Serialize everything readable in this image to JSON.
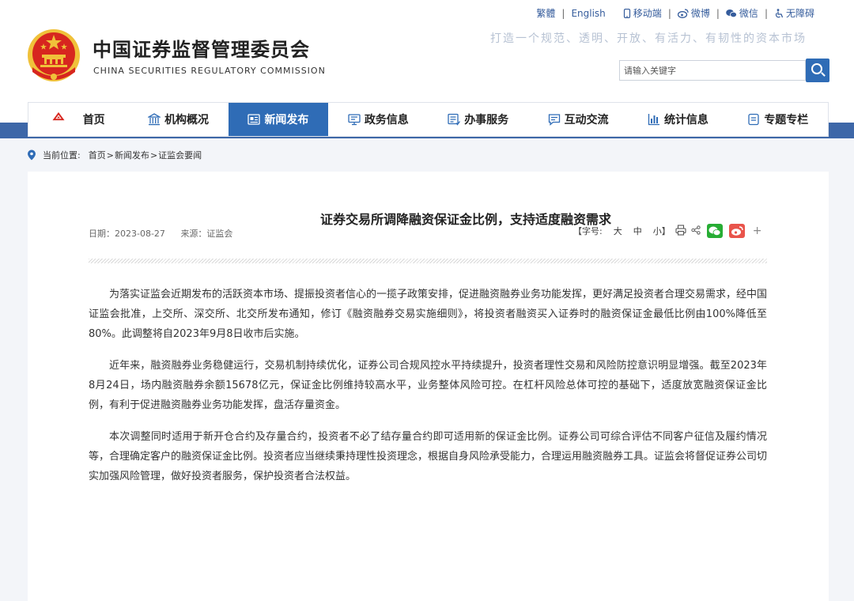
{
  "header": {
    "title_cn": "中国证券监督管理委员会",
    "title_en": "CHINA SECURITIES REGULATORY COMMISSION",
    "slogan": "打造一个规范、透明、开放、有活力、有韧性的资本市场",
    "util_links": {
      "traditional": "繁體",
      "english": "English",
      "mobile": "移动端",
      "weibo": "微博",
      "wechat": "微信",
      "accessibility": "无障碍"
    },
    "search_placeholder": "请输入关键字"
  },
  "nav": [
    {
      "label": "首页",
      "icon": "home-logo-icon"
    },
    {
      "label": "机构概况",
      "icon": "institution-icon"
    },
    {
      "label": "新闻发布",
      "icon": "news-icon",
      "active": true
    },
    {
      "label": "政务信息",
      "icon": "monitor-icon"
    },
    {
      "label": "办事服务",
      "icon": "list-icon"
    },
    {
      "label": "互动交流",
      "icon": "chat-icon"
    },
    {
      "label": "统计信息",
      "icon": "chart-icon"
    },
    {
      "label": "专题专栏",
      "icon": "topic-icon"
    }
  ],
  "breadcrumb": {
    "prefix": "当前位置:",
    "items": [
      "首页",
      "新闻发布",
      "证监会要闻"
    ],
    "sep": ">"
  },
  "article": {
    "title": "证券交易所调降融资保证金比例，支持适度融资需求",
    "date_label": "日期：2023-08-27",
    "source_label": "来源：证监会",
    "font_size_label": "【字号:",
    "font_sizes": [
      "大",
      "中",
      "小"
    ],
    "font_close": "】",
    "plus": "+",
    "paragraphs": [
      "为落实证监会近期发布的活跃资本市场、提振投资者信心的一揽子政策安排，促进融资融券业务功能发挥，更好满足投资者合理交易需求，经中国证监会批准，上交所、深交所、北交所发布通知，修订《融资融券交易实施细则》，将投资者融资买入证券时的融资保证金最低比例由100%降低至80%。此调整将自2023年9月8日收市后实施。",
      "近年来，融资融券业务稳健运行，交易机制持续优化，证券公司合规风控水平持续提升，投资者理性交易和风险防控意识明显增强。截至2023年8月24日，场内融资融券余额15678亿元，保证金比例维持较高水平，业务整体风险可控。在杠杆风险总体可控的基础下，适度放宽融资保证金比例，有利于促进融资融券业务功能发挥，盘活存量资金。",
      "本次调整同时适用于新开仓合约及存量合约，投资者不必了结存量合约即可适用新的保证金比例。证券公司可综合评估不同客户征信及履约情况等，合理确定客户的融资保证金比例。投资者应当继续秉持理性投资理念，根据自身风险承受能力，合理运用融资融券工具。证监会将督促证券公司切实加强风险管理，做好投资者服务，保护投资者合法权益。"
    ]
  },
  "colors": {
    "brand_blue": "#2f6cb6",
    "band_blue": "#3d67a8",
    "emblem_red": "#d7261f",
    "emblem_gold": "#f0c13a"
  }
}
